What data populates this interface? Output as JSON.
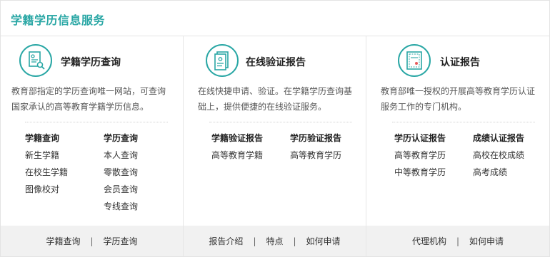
{
  "header": {
    "title": "学籍学历信息服务"
  },
  "columns": [
    {
      "title": "学籍学历查询",
      "icon": "document-search-icon",
      "desc_lines": [
        "教育部指定的学历查询唯一网站，可查询",
        "国家承认的高等教育学籍学历信息。"
      ],
      "groups": [
        {
          "head": "学籍查询",
          "links": [
            "新生学籍",
            "在校生学籍",
            "图像校对"
          ]
        },
        {
          "head": "学历查询",
          "links": [
            "本人查询",
            "零散查询",
            "会员查询",
            "专线查询"
          ]
        }
      ],
      "footer": [
        "学籍查询",
        "学历查询"
      ]
    },
    {
      "title": "在线验证报告",
      "icon": "report-icon",
      "desc_lines": [
        "在线快捷申请、验证。在学籍学历查询基",
        "础上，提供便捷的在线验证服务。"
      ],
      "groups": [
        {
          "head": "学籍验证报告",
          "links": [
            "高等教育学籍"
          ]
        },
        {
          "head": "学历验证报告",
          "links": [
            "高等教育学历"
          ]
        }
      ],
      "footer": [
        "报告介绍",
        "特点",
        "如何申请"
      ]
    },
    {
      "title": "认证报告",
      "icon": "certificate-icon",
      "desc_lines": [
        "教育部唯一授权的开展高等教育学历认证",
        "服务工作的专门机构。"
      ],
      "groups": [
        {
          "head": "学历认证报告",
          "links": [
            "高等教育学历",
            "中等教育学历"
          ]
        },
        {
          "head": "成绩认证报告",
          "links": [
            "高校在校成绩",
            "高考成绩"
          ]
        }
      ],
      "footer": [
        "代理机构",
        "如何申请"
      ]
    }
  ],
  "footer_separator": "|",
  "colors": {
    "accent": "#2aa7a5",
    "footer_bg": "#f1f1f1"
  }
}
